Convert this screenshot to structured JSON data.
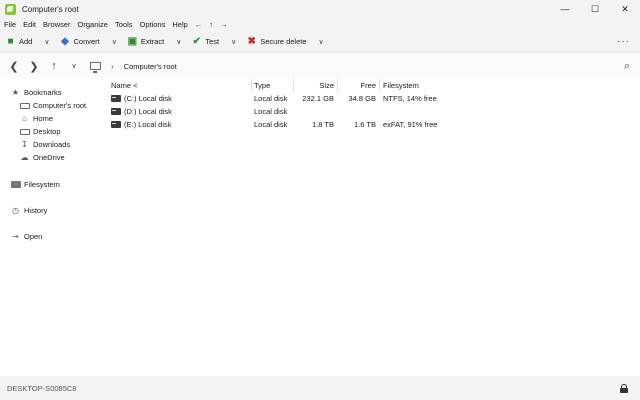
{
  "window": {
    "title": "Computer's root",
    "minimize_icon": "—",
    "maximize_icon": "☐",
    "close_icon": "✕"
  },
  "menu": {
    "items": [
      "File",
      "Edit",
      "Browser",
      "Organize",
      "Tools",
      "Options",
      "Help"
    ],
    "nav": [
      "←",
      "↑",
      "→"
    ]
  },
  "toolbar": {
    "add_label": "Add",
    "convert_label": "Convert",
    "extract_label": "Extract",
    "test_label": "Test",
    "secure_delete_label": "Secure delete",
    "more_icon": "···",
    "dropdown_icon": "∨",
    "colors": {
      "add": "#2e8b2e",
      "convert": "#3b6fc4",
      "extract": "#2e8b2e",
      "test": "#2e9b2e",
      "secure_delete": "#d42020"
    }
  },
  "address": {
    "back_icon": "❮",
    "forward_icon": "❯",
    "up_icon": "↑",
    "dropdown_icon": "∨",
    "separator": "›",
    "breadcrumb": "Computer's root",
    "search_icon": "⌕"
  },
  "sidebar": {
    "bookmarks_label": "Bookmarks",
    "bookmarks": [
      {
        "label": "Computer's root",
        "icon": "monitor-icon"
      },
      {
        "label": "Home",
        "icon": "home-icon"
      },
      {
        "label": "Desktop",
        "icon": "desktop-icon"
      },
      {
        "label": "Downloads",
        "icon": "download-icon"
      },
      {
        "label": "OneDrive",
        "icon": "cloud-icon"
      }
    ],
    "filesystem_label": "Filesystem",
    "history_label": "History",
    "open_label": "Open"
  },
  "table": {
    "headers": {
      "name": "Name <",
      "type": "Type",
      "size": "Size",
      "free": "Free",
      "filesystem": "Filesystem"
    },
    "rows": [
      {
        "name": "(C:) Local disk",
        "type": "Local disk",
        "size": "232.1 GB",
        "free": "34.8 GB",
        "filesystem": "NTFS, 14% free"
      },
      {
        "name": "(D:) Local disk",
        "type": "Local disk",
        "size": "",
        "free": "",
        "filesystem": ""
      },
      {
        "name": "(E:) Local disk",
        "type": "Local disk",
        "size": "1.8 TB",
        "free": "1.6 TB",
        "filesystem": "exFAT, 91% free"
      }
    ]
  },
  "status": {
    "computer_name": "DESKTOP-S0085C8"
  }
}
